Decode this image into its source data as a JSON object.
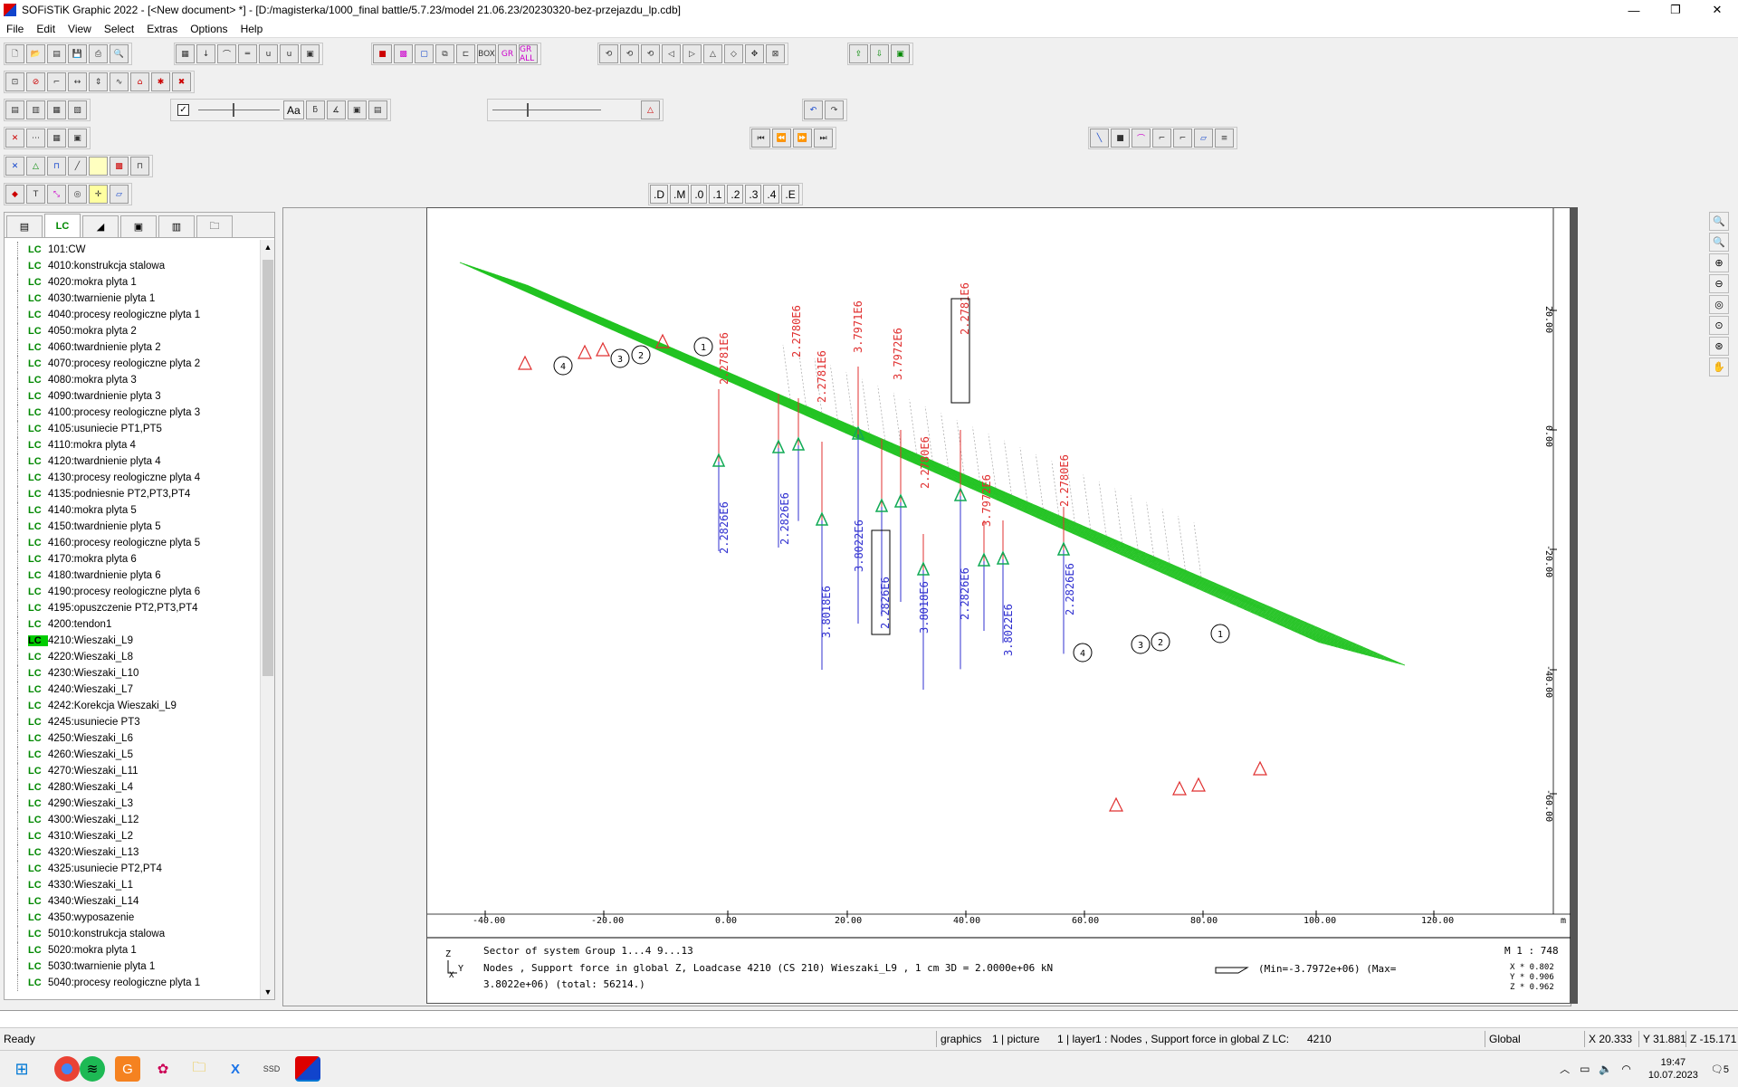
{
  "window": {
    "title": "SOFiSTiK Graphic 2022 - [<New document> *] - [D:/magisterka/1000_final battle/5.7.23/model 21.06.23/20230320-bez-przejazdu_lp.cdb]",
    "minimize": "—",
    "restore": "❐",
    "close": "✕"
  },
  "menu": [
    "File",
    "Edit",
    "View",
    "Select",
    "Extras",
    "Options",
    "Help"
  ],
  "toolbar": {
    "font_button": "Aa",
    "view_buttons": [
      ".D",
      ".M",
      ".0",
      ".1",
      ".2",
      ".3",
      ".4",
      ".E"
    ],
    "box_label": "BOX",
    "gr_label": "GR",
    "gr_all_label": "GR ALL",
    "checkbox_mark": "✓"
  },
  "left_panel": {
    "tabs": [
      "",
      "LC",
      "",
      "",
      "",
      ""
    ],
    "selected_index": 24,
    "loadcases": [
      {
        "id": "101",
        "name": "CW"
      },
      {
        "id": "4010",
        "name": "konstrukcja stalowa"
      },
      {
        "id": "4020",
        "name": "mokra plyta 1"
      },
      {
        "id": "4030",
        "name": "twarnienie plyta 1"
      },
      {
        "id": "4040",
        "name": "procesy reologiczne plyta 1"
      },
      {
        "id": "4050",
        "name": "mokra plyta 2"
      },
      {
        "id": "4060",
        "name": "twardnienie plyta 2"
      },
      {
        "id": "4070",
        "name": "procesy reologiczne plyta 2"
      },
      {
        "id": "4080",
        "name": "mokra plyta 3"
      },
      {
        "id": "4090",
        "name": "twardnienie plyta 3"
      },
      {
        "id": "4100",
        "name": "procesy reologiczne plyta 3"
      },
      {
        "id": "4105",
        "name": "usuniecie PT1,PT5"
      },
      {
        "id": "4110",
        "name": "mokra plyta 4"
      },
      {
        "id": "4120",
        "name": "twardnienie plyta 4"
      },
      {
        "id": "4130",
        "name": "procesy reologiczne plyta 4"
      },
      {
        "id": "4135",
        "name": "podniesnie PT2,PT3,PT4"
      },
      {
        "id": "4140",
        "name": "mokra plyta 5"
      },
      {
        "id": "4150",
        "name": "twardnienie plyta 5"
      },
      {
        "id": "4160",
        "name": "procesy reologiczne plyta 5"
      },
      {
        "id": "4170",
        "name": "mokra plyta 6"
      },
      {
        "id": "4180",
        "name": "twardnienie plyta 6"
      },
      {
        "id": "4190",
        "name": "procesy reologiczne plyta 6"
      },
      {
        "id": "4195",
        "name": "opuszczenie PT2,PT3,PT4"
      },
      {
        "id": "4200",
        "name": "tendon1"
      },
      {
        "id": "4210",
        "name": "Wieszaki_L9"
      },
      {
        "id": "4220",
        "name": "Wieszaki_L8"
      },
      {
        "id": "4230",
        "name": "Wieszaki_L10"
      },
      {
        "id": "4240",
        "name": "Wieszaki_L7"
      },
      {
        "id": "4242",
        "name": "Korekcja Wieszaki_L9"
      },
      {
        "id": "4245",
        "name": "usuniecie PT3"
      },
      {
        "id": "4250",
        "name": "Wieszaki_L6"
      },
      {
        "id": "4260",
        "name": "Wieszaki_L5"
      },
      {
        "id": "4270",
        "name": "Wieszaki_L11"
      },
      {
        "id": "4280",
        "name": "Wieszaki_L4"
      },
      {
        "id": "4290",
        "name": "Wieszaki_L3"
      },
      {
        "id": "4300",
        "name": "Wieszaki_L12"
      },
      {
        "id": "4310",
        "name": "Wieszaki_L2"
      },
      {
        "id": "4320",
        "name": "Wieszaki_L13"
      },
      {
        "id": "4325",
        "name": "usuniecie PT2,PT4"
      },
      {
        "id": "4330",
        "name": "Wieszaki_L1"
      },
      {
        "id": "4340",
        "name": "Wieszaki_L14"
      },
      {
        "id": "4350",
        "name": "wyposazenie"
      },
      {
        "id": "5010",
        "name": "konstrukcja stalowa"
      },
      {
        "id": "5020",
        "name": "mokra plyta 1"
      },
      {
        "id": "5030",
        "name": "twarnienie plyta 1"
      },
      {
        "id": "5040",
        "name": "procesy reologiczne plyta 1"
      }
    ],
    "lc_prefix": "LC"
  },
  "graphic": {
    "x_axis_ticks": [
      "-40.00",
      "-20.00",
      "0.00",
      "20.00",
      "40.00",
      "60.00",
      "80.00",
      "100.00",
      "120.00"
    ],
    "x_unit": "m",
    "y_axis_ticks": [
      "20.00",
      "0.00",
      "-20.00",
      "-40.00",
      "-60.00"
    ],
    "red_labels": [
      "2.2781E6",
      "2.2780E6",
      "2.2781E6",
      "3.7971E6",
      "3.7972E6",
      "2.2780E6",
      "2.2781E6",
      "3.7972E6",
      "2.2780E6"
    ],
    "blue_labels": [
      "2.2826E6",
      "2.2826E6",
      "3.8018E6",
      "3.8022E6",
      "2.2826E6",
      "3.8018E6",
      "2.2826E6",
      "3.8022E6",
      "2.2826E6"
    ],
    "circle_labels": [
      "1",
      "2",
      "3",
      "4",
      "1",
      "2",
      "3",
      "4"
    ],
    "info_line1": "Sector of system Group 1...4 9...13",
    "info_line2": "Nodes , Support force in global Z, Loadcase 4210  (CS 210) Wieszaki_L9   , 1 cm 3D =   2.0000e+06 kN",
    "info_line3": "3.8022e+06) (total: 56214.)",
    "info_minmax": "(Min=-3.7972e+06) (Max=",
    "scale": "M 1 : 748",
    "axis_z": "Z",
    "axis_y": "Y",
    "axis_x": "X",
    "dir_x": "X * 0.802",
    "dir_y": "Y * 0.906",
    "dir_z": "Z * 0.962"
  },
  "status": {
    "ready": "Ready",
    "graphics": "graphics",
    "picture": "1 | picture",
    "layer": "1 | layer",
    "lc_desc": "1 : Nodes , Support force in global Z  LC:",
    "lc_num": "4210",
    "coord_sys": "Global",
    "x": "X 20.333",
    "y": "Y 31.881",
    "z": "Z -15.171"
  },
  "taskbar": {
    "time": "19:47",
    "date": "10.07.2023",
    "notify_count": "5"
  },
  "colors": {
    "mesh": "#22c322",
    "reaction_pos": "#e03030",
    "reaction_neg": "#3030d0",
    "selected_lc": "#00cc00"
  }
}
